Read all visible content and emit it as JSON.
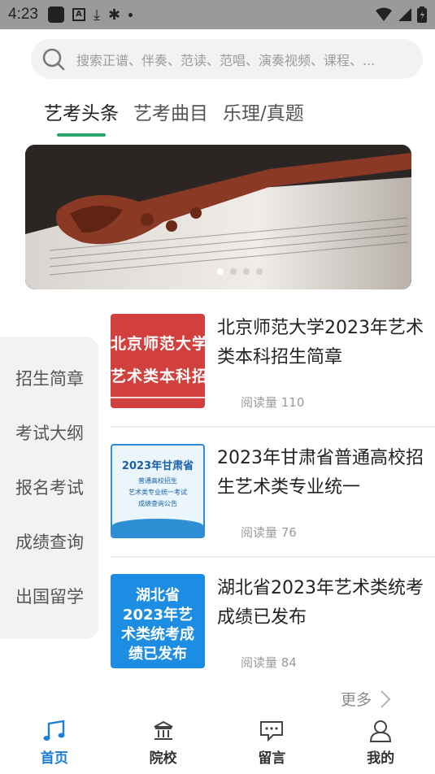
{
  "status_bar": {
    "time": "4:23"
  },
  "search": {
    "placeholder": "搜索正谱、伴奏、范读、范唱、演奏视频、课程、..."
  },
  "tabs": [
    {
      "label": "艺考头条",
      "active": true
    },
    {
      "label": "艺考曲目",
      "active": false
    },
    {
      "label": "乐理/真题",
      "active": false
    }
  ],
  "banner": {
    "dots": 4,
    "active_index": 0
  },
  "sidebar": {
    "items": [
      "招生简章",
      "考试大纲",
      "报名考试",
      "成绩查询",
      "出国留学"
    ]
  },
  "news": [
    {
      "title": "北京师范大学2023年艺术类本科招生简章",
      "reads": "阅读量 110",
      "thumb_lines": [
        "北京师范大学",
        "艺术类本科招"
      ]
    },
    {
      "title": "2023年甘肃省普通高校招生艺术类专业统一",
      "reads": "阅读量 76",
      "thumb_lines": [
        "2023年甘肃省",
        "普通高校招生",
        "艺术类专业统一考试",
        "成绩查询公告"
      ]
    },
    {
      "title": "湖北省2023年艺术类统考成绩已发布",
      "reads": "阅读量 84",
      "thumb_lines": [
        "湖北省",
        "2023年艺",
        "术类统考成",
        "绩已发布"
      ]
    }
  ],
  "more": {
    "label": "更多"
  },
  "bottom_nav": [
    {
      "label": "首页",
      "icon": "music-note-icon",
      "active": true
    },
    {
      "label": "院校",
      "icon": "institution-icon",
      "active": false
    },
    {
      "label": "留言",
      "icon": "message-icon",
      "active": false
    },
    {
      "label": "我的",
      "icon": "user-icon",
      "active": false
    }
  ],
  "colors": {
    "accent_green": "#2aa56b",
    "nav_active_blue": "#1f7fd6",
    "status_bar": "#9a9a9a"
  }
}
